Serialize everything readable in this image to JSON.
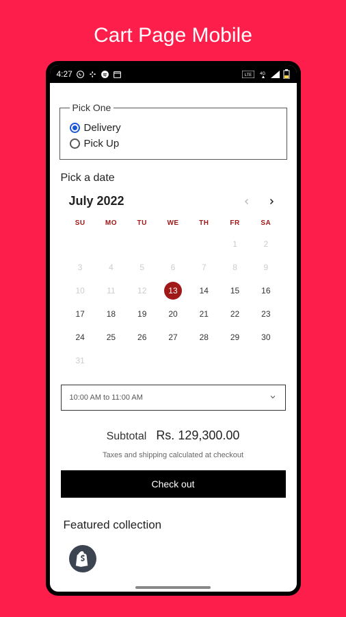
{
  "page_title": "Cart Page Mobile",
  "status_bar": {
    "time": "4:27"
  },
  "fieldset": {
    "legend": "Pick One",
    "options": [
      {
        "label": "Delivery",
        "checked": true
      },
      {
        "label": "Pick Up",
        "checked": false
      }
    ]
  },
  "pick_date_label": "Pick a date",
  "calendar": {
    "title": "July 2022",
    "weekdays": [
      "SU",
      "MO",
      "TU",
      "WE",
      "TH",
      "FR",
      "SA"
    ],
    "weeks": [
      [
        {
          "n": "",
          "d": true
        },
        {
          "n": "",
          "d": true
        },
        {
          "n": "",
          "d": true
        },
        {
          "n": "",
          "d": true
        },
        {
          "n": "",
          "d": true
        },
        {
          "n": "1",
          "d": true
        },
        {
          "n": "2",
          "d": true
        }
      ],
      [
        {
          "n": "3",
          "d": true
        },
        {
          "n": "4",
          "d": true
        },
        {
          "n": "5",
          "d": true
        },
        {
          "n": "6",
          "d": true
        },
        {
          "n": "7",
          "d": true
        },
        {
          "n": "8",
          "d": true
        },
        {
          "n": "9",
          "d": true
        }
      ],
      [
        {
          "n": "10",
          "d": true
        },
        {
          "n": "11",
          "d": true
        },
        {
          "n": "12",
          "d": true
        },
        {
          "n": "13",
          "sel": true
        },
        {
          "n": "14"
        },
        {
          "n": "15"
        },
        {
          "n": "16"
        }
      ],
      [
        {
          "n": "17"
        },
        {
          "n": "18"
        },
        {
          "n": "19"
        },
        {
          "n": "20"
        },
        {
          "n": "21"
        },
        {
          "n": "22"
        },
        {
          "n": "23"
        }
      ],
      [
        {
          "n": "24"
        },
        {
          "n": "25"
        },
        {
          "n": "26"
        },
        {
          "n": "27"
        },
        {
          "n": "28"
        },
        {
          "n": "29"
        },
        {
          "n": "30"
        }
      ],
      [
        {
          "n": "31",
          "d": true
        },
        {
          "n": ""
        },
        {
          "n": ""
        },
        {
          "n": ""
        },
        {
          "n": ""
        },
        {
          "n": ""
        },
        {
          "n": ""
        }
      ]
    ]
  },
  "time_select": {
    "value": "10:00 AM to 11:00 AM"
  },
  "subtotal": {
    "label": "Subtotal",
    "value": "Rs. 129,300.00"
  },
  "tax_note": "Taxes and shipping calculated at checkout",
  "checkout_label": "Check out",
  "featured_label": "Featured collection"
}
